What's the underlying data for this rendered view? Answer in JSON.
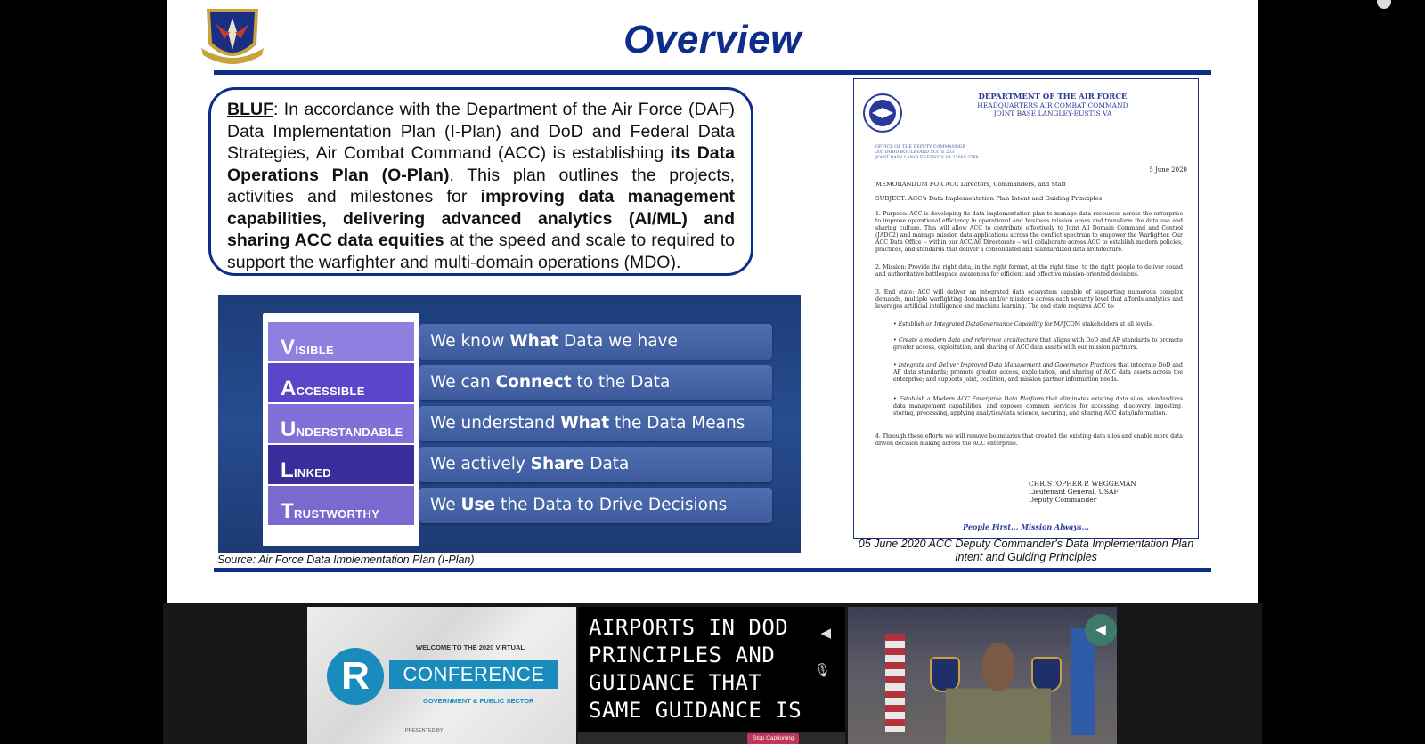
{
  "slide": {
    "title": "Overview",
    "bluf": {
      "lead": "BLUF",
      "p1": ": In accordance with the Department of the Air Force (DAF) Data Implementation Plan (I-Plan) and DoD and Federal Data Strategies, Air Combat Command (ACC) is establishing ",
      "b1": "its Data Operations Plan (O-Plan)",
      "p2": ".  This plan outlines the projects, activities and milestones for ",
      "b2": "improving data management capabilities, delivering advanced analytics (AI/ML) and sharing ACC data equities",
      "p3": " at the speed and scale to required to support the warfighter and multi-domain operations (MDO)."
    },
    "vauth": [
      {
        "cap": "V",
        "rest": "isible",
        "pre": "We know ",
        "bold": "What",
        "post": " Data we have",
        "color": "#8f7fe0"
      },
      {
        "cap": "A",
        "rest": "ccessible",
        "pre": "We can ",
        "bold": "Connect",
        "post": " to the Data",
        "color": "#5a46c8"
      },
      {
        "cap": "U",
        "rest": "nderstandable",
        "pre": "We understand ",
        "bold": "What",
        "post": " the Data Means",
        "color": "#8070d8"
      },
      {
        "cap": "L",
        "rest": "inked",
        "pre": "We actively ",
        "bold": "Share",
        "post": " Data",
        "color": "#3a2c9a"
      },
      {
        "cap": "T",
        "rest": "rustworthy",
        "pre": "We ",
        "bold": "Use",
        "post": " the Data to Drive Decisions",
        "color": "#7a6ad0"
      }
    ],
    "source": "Source: Air Force Data Implementation Plan (I-Plan)",
    "memo": {
      "hdr1": "DEPARTMENT OF THE AIR FORCE",
      "hdr2": "HEADQUARTERS AIR COMBAT COMMAND",
      "hdr3": "JOINT BASE LANGLEY-EUSTIS VA",
      "office": "OFFICE OF THE DEPUTY COMMANDER\n205 DODD BOULEVARD SUITE 203\nJOINT BASE LANGLEY-EUSTIS VA  23665-2788",
      "date": "5 June 2020",
      "memo_for": "MEMORANDUM FOR    ACC Directors, Commanders, and Staff",
      "subject": "SUBJECT:  ACC's Data Implementation Plan Intent and Guiding Principles",
      "p1": "1.  Purpose: ACC is developing its data implementation plan to manage data resources across the enterprise to improve operational efficiency in operational and business mission areas and transform the data use and sharing culture. This will allow ACC to contribute effectively to Joint All Domain Command and Control (JADC2) and manage mission data-applications across the conflict spectrum to empower the Warfighter. Our ACC Data Office -- within our ACC/A6 Directorate -- will collaborate across ACC to establish modern policies, practices, and standards that deliver a consolidated and standardized data architecture.",
      "p2": "2.  Mission:  Provide the right data, in the right format, at the right time, to the right people to deliver sound and authoritative battlespace awareness for efficient and effective mission-oriented decisions.",
      "p3": "3.  End state: ACC will deliver an integrated data ecosystem capable of supporting numerous complex demands, multiple warfighting domains and/or missions across each security level that affords analytics and leverages artificial intelligence and machine learning. The end state requires ACC to:",
      "b1_i": "Establish an Integrated DataGovernance Capability",
      "b1": " for MAJCOM stakeholders at all levels.",
      "b2_i": "Create a modern data and reference architecture",
      "b2": " that aligns with DoD and AF standards to promote greater access, exploitation, and sharing of ACC data assets with our mission partners.",
      "b3_i": "Integrate and Deliver Improved Data Management and Governance Practices",
      "b3": " that integrate DoD and AF data standards; promote greater access, exploitation, and sharing of ACC data assets across the enterprise; and supports joint, coalition, and mission partner information needs.",
      "b4_i": "Establish a Modern ACC Enterprise Data Platform",
      "b4": " that eliminates existing data silos, standardizes data management capabilities, and exposes common services for accessing, discovery, ingesting, storing, processing, applying analytics/data science, securing, and sharing ACC data/information.",
      "p4": "4.  Through these efforts we will remove boundaries that created the existing data silos and enable more data driven decision making across the ACC enterprise.",
      "sig_name": "CHRISTOPHER P. WEGGEMAN",
      "sig_rank": "Lieutenant General, USAF",
      "sig_title": "Deputy Commander",
      "footer": "People First... Mission Always..."
    },
    "caption": "05 June 2020 ACC Deputy Commander's Data Implementation Plan Intent and Guiding Principles"
  },
  "conference_tile": {
    "welcome": "WELCOME TO THE 2020 VIRTUAL",
    "logo_letter": "R",
    "name": "CONFERENCE",
    "sub": "GOVERNMENT & PUBLIC SECTOR",
    "presented": "PRESENTED BY"
  },
  "caption_tile": {
    "text": "AIRPORTS IN DOD\nPRINCIPLES AND\nGUIDANCE THAT\nSAME GUIDANCE IS",
    "stop_label": "Stop Captioning"
  },
  "icons": {
    "speaker": "speaker-icon",
    "mic": "microphone-icon"
  }
}
